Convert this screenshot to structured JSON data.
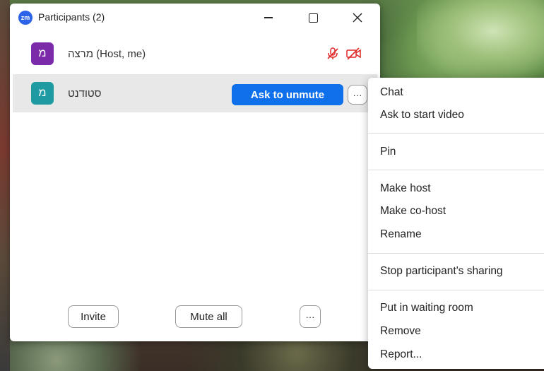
{
  "window": {
    "app_logo": "zm",
    "title": "Participants (2)"
  },
  "participants": [
    {
      "avatar_letter": "מ",
      "avatar_color": "#7b2ba8",
      "name": "מרצה (Host, me)",
      "mic_icon": "mic-muted-icon",
      "video_icon": "video-off-icon",
      "status_color": "#e02828"
    },
    {
      "avatar_letter": "מ",
      "avatar_color": "#1e9aa2",
      "name": "סטודנט",
      "action_label": "Ask to unmute",
      "more_label": "···"
    }
  ],
  "footer": {
    "invite_label": "Invite",
    "mute_all_label": "Mute all",
    "more_label": "···"
  },
  "context_menu": {
    "groups": [
      [
        "Chat",
        "Ask to start video"
      ],
      [
        "Pin"
      ],
      [
        "Make host",
        "Make co-host",
        "Rename"
      ],
      [
        "Stop participant's sharing"
      ],
      [
        "Put in waiting room",
        "Remove",
        "Report..."
      ]
    ]
  }
}
